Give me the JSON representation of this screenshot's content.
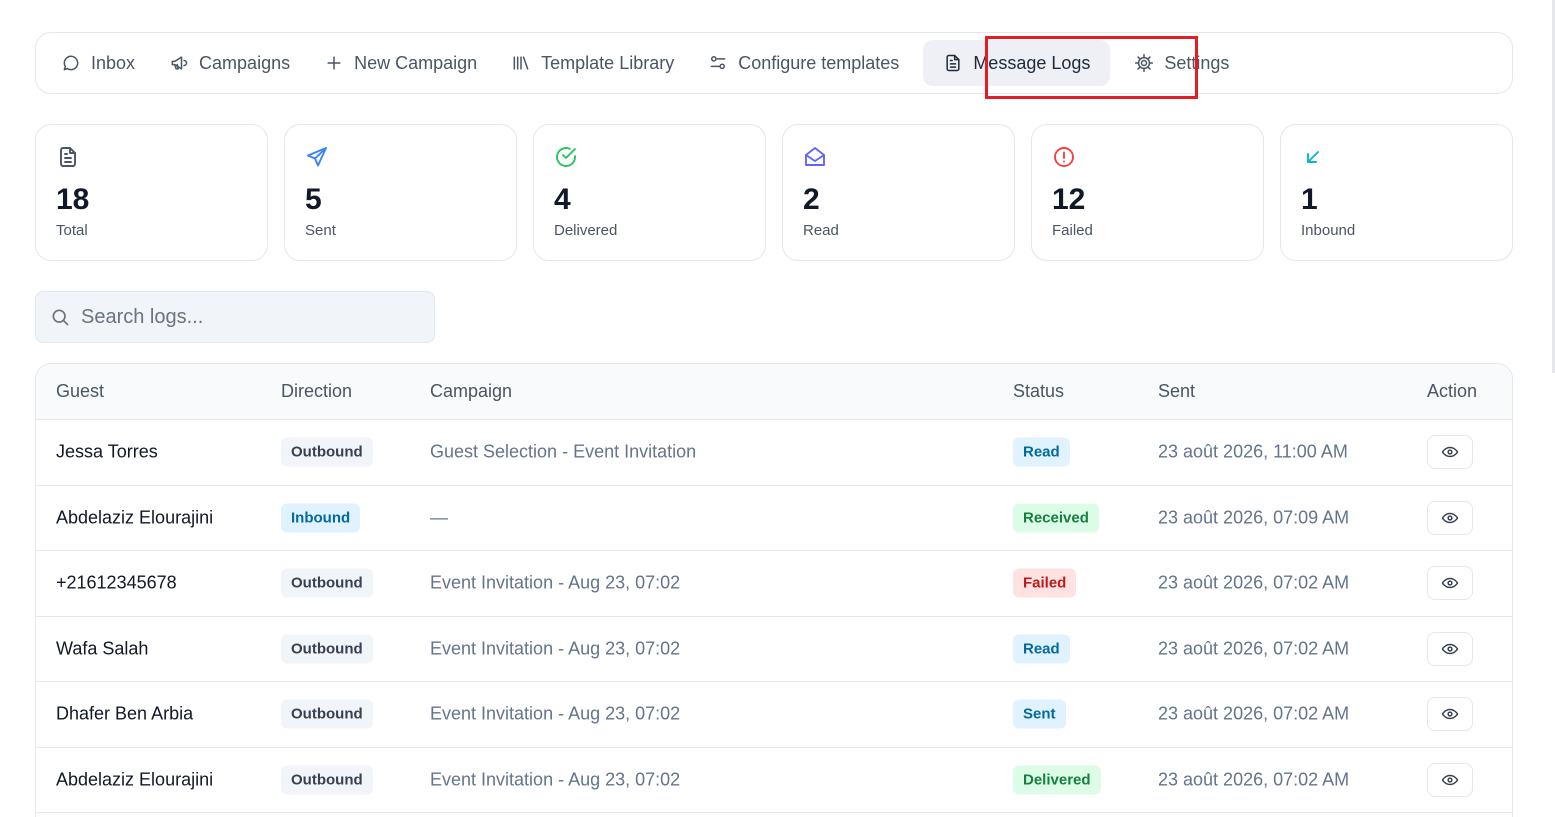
{
  "nav": {
    "items": [
      {
        "label": "Inbox",
        "icon": "chat-bubble-icon"
      },
      {
        "label": "Campaigns",
        "icon": "megaphone-icon"
      },
      {
        "label": "New Campaign",
        "icon": "plus-icon"
      },
      {
        "label": "Template Library",
        "icon": "library-icon"
      },
      {
        "label": "Configure templates",
        "icon": "sliders-icon"
      },
      {
        "label": "Message Logs",
        "icon": "document-icon",
        "active": true
      },
      {
        "label": "Settings",
        "icon": "gear-icon"
      }
    ]
  },
  "stats": [
    {
      "value": "18",
      "label": "Total",
      "icon": "document-icon",
      "color": "#4b5563"
    },
    {
      "value": "5",
      "label": "Sent",
      "icon": "send-icon",
      "color": "#3b82f6"
    },
    {
      "value": "4",
      "label": "Delivered",
      "icon": "check-circle-icon",
      "color": "#22c55e"
    },
    {
      "value": "2",
      "label": "Read",
      "icon": "mail-open-icon",
      "color": "#6366f1"
    },
    {
      "value": "12",
      "label": "Failed",
      "icon": "alert-circle-icon",
      "color": "#ef4444"
    },
    {
      "value": "1",
      "label": "Inbound",
      "icon": "arrow-down-left-icon",
      "color": "#06b6d4"
    }
  ],
  "search": {
    "placeholder": "Search logs..."
  },
  "table": {
    "headers": {
      "guest": "Guest",
      "direction": "Direction",
      "campaign": "Campaign",
      "status": "Status",
      "sent": "Sent",
      "action": "Action"
    },
    "rows": [
      {
        "guest": "Jessa Torres",
        "direction": "Outbound",
        "campaign": "Guest Selection - Event Invitation",
        "status": "Read",
        "sent": "23 août 2026, 11:00 AM"
      },
      {
        "guest": "Abdelaziz Elourajini",
        "direction": "Inbound",
        "campaign": "—",
        "status": "Received",
        "sent": "23 août 2026, 07:09 AM"
      },
      {
        "guest": "+21612345678",
        "direction": "Outbound",
        "campaign": "Event Invitation - Aug 23, 07:02",
        "status": "Failed",
        "sent": "23 août 2026, 07:02 AM"
      },
      {
        "guest": "Wafa Salah",
        "direction": "Outbound",
        "campaign": "Event Invitation - Aug 23, 07:02",
        "status": "Read",
        "sent": "23 août 2026, 07:02 AM"
      },
      {
        "guest": "Dhafer Ben Arbia",
        "direction": "Outbound",
        "campaign": "Event Invitation - Aug 23, 07:02",
        "status": "Sent",
        "sent": "23 août 2026, 07:02 AM"
      },
      {
        "guest": "Abdelaziz Elourajini",
        "direction": "Outbound",
        "campaign": "Event Invitation - Aug 23, 07:02",
        "status": "Delivered",
        "sent": "23 août 2026, 07:02 AM"
      }
    ]
  }
}
